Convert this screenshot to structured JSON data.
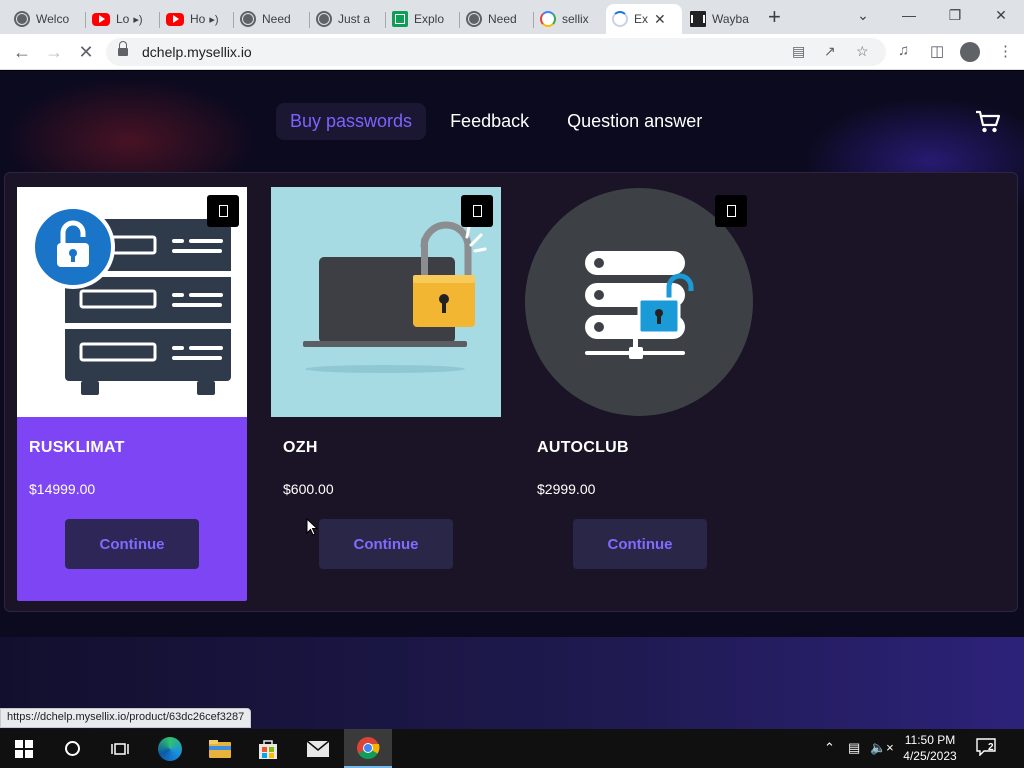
{
  "browser": {
    "tabs": [
      {
        "title": "Welco",
        "icon": "globe-icon",
        "audio": false,
        "active": false
      },
      {
        "title": "Lo",
        "icon": "youtube-icon",
        "audio": true,
        "active": false
      },
      {
        "title": "Ho",
        "icon": "youtube-icon",
        "audio": true,
        "active": false
      },
      {
        "title": "Need",
        "icon": "globe-icon",
        "audio": false,
        "active": false
      },
      {
        "title": "Just a",
        "icon": "globe-icon",
        "audio": false,
        "active": false
      },
      {
        "title": "Explo",
        "icon": "sheets-icon",
        "audio": false,
        "active": false
      },
      {
        "title": "Need",
        "icon": "globe-icon",
        "audio": false,
        "active": false
      },
      {
        "title": "sellix",
        "icon": "google-icon",
        "audio": false,
        "active": false
      },
      {
        "title": "Ex",
        "icon": "loading-icon",
        "audio": false,
        "active": true
      },
      {
        "title": "Wayba",
        "icon": "archive-icon",
        "audio": false,
        "active": false
      }
    ],
    "address": "dchelp.mysellix.io",
    "status_url": "https://dchelp.mysellix.io/product/63dc26cef3287"
  },
  "site": {
    "nav": [
      "Buy passwords",
      "Feedback",
      "Question answer"
    ],
    "active_nav": "Buy passwords",
    "accent_color": "#7e45f5",
    "products": [
      {
        "name": "RUSKLIMAT",
        "price": "$14999.00",
        "button": "Continue",
        "image": "server-lock-icon",
        "highlighted": true
      },
      {
        "name": "OZH",
        "price": "$600.00",
        "button": "Continue",
        "image": "laptop-padlock-icon",
        "highlighted": false
      },
      {
        "name": "AUTOCLUB",
        "price": "$2999.00",
        "button": "Continue",
        "image": "database-lock-icon",
        "highlighted": false
      }
    ]
  },
  "taskbar": {
    "time": "11:50 PM",
    "date": "4/25/2023",
    "notifications": "2"
  }
}
